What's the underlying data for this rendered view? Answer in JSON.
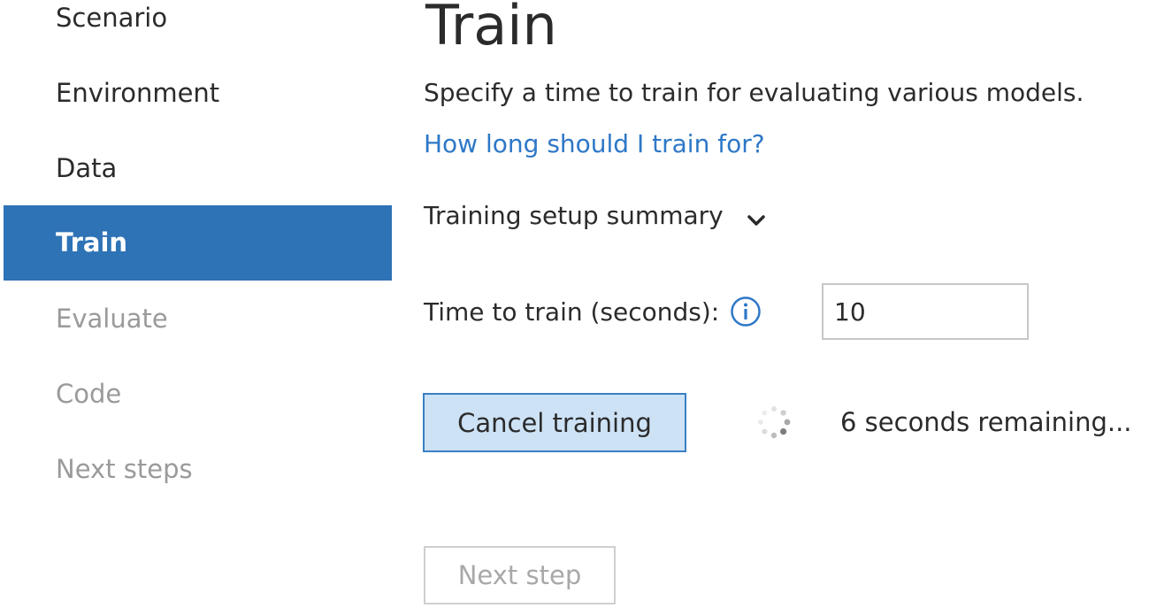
{
  "sidebar": {
    "items": [
      {
        "label": "Scenario",
        "state": "enabled"
      },
      {
        "label": "Environment",
        "state": "enabled"
      },
      {
        "label": "Data",
        "state": "enabled"
      },
      {
        "label": "Train",
        "state": "active"
      },
      {
        "label": "Evaluate",
        "state": "disabled"
      },
      {
        "label": "Code",
        "state": "disabled"
      },
      {
        "label": "Next steps",
        "state": "disabled"
      }
    ]
  },
  "main": {
    "title": "Train",
    "description": "Specify a time to train for evaluating various models.",
    "help_link": "How long should I train for?",
    "summary_label": "Training setup summary",
    "time_label": "Time to train (seconds):",
    "time_value": "10",
    "cancel_label": "Cancel training",
    "status": "6 seconds remaining...",
    "next_label": "Next step"
  },
  "icons": {
    "chevron": "chevron-down-icon",
    "info": "info-icon",
    "spinner": "spinner-icon"
  },
  "colors": {
    "accent": "#2e73b6",
    "link": "#2e78c7",
    "button_fill": "#cde2f5",
    "button_border": "#3b7fc4",
    "disabled_text": "#9a9a9a"
  }
}
